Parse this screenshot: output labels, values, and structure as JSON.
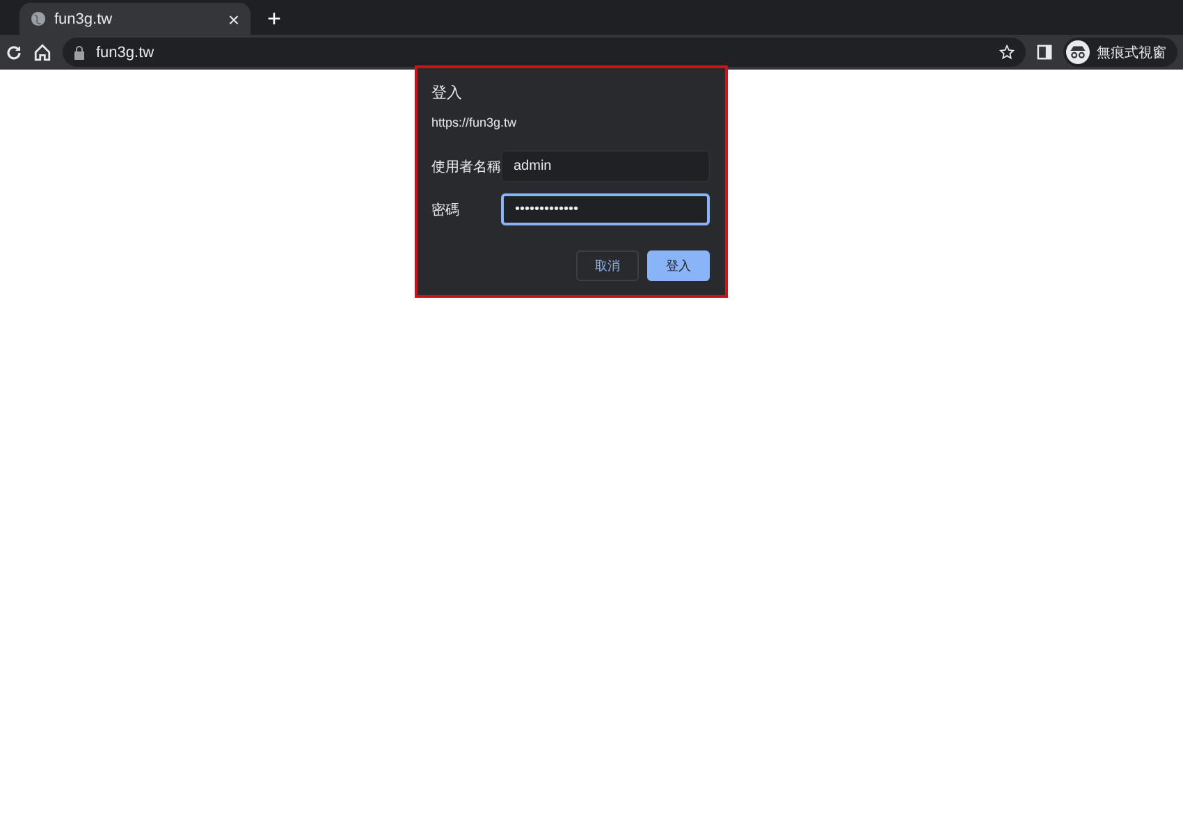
{
  "tab": {
    "title": "fun3g.tw",
    "close": "×",
    "new_tab": "+"
  },
  "address_bar": {
    "url": "fun3g.tw"
  },
  "profile": {
    "label": "無痕式視窗"
  },
  "dialog": {
    "title": "登入",
    "origin": "https://fun3g.tw",
    "highlighted": true,
    "fields": [
      {
        "label": "使用者名稱",
        "value": "admin",
        "focused": false
      },
      {
        "label": "密碼",
        "value": "•••••••••••••",
        "focused": true
      }
    ],
    "buttons": [
      {
        "label": "取消",
        "primary": false
      },
      {
        "label": "登入",
        "primary": true
      }
    ]
  }
}
